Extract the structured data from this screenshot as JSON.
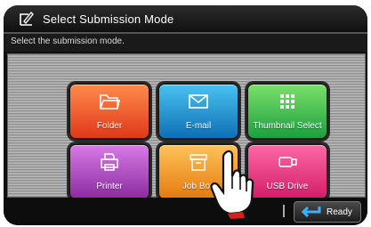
{
  "header": {
    "title": "Select Submission Mode",
    "icon": "pen-paper-icon"
  },
  "instruction": "Select the submission mode.",
  "tiles": [
    {
      "label": "Folder",
      "icon": "folder-icon",
      "color": "#f15a24"
    },
    {
      "label": "E-mail",
      "icon": "envelope-icon",
      "color": "#1e90d6"
    },
    {
      "label": "Thumbnail Select",
      "icon": "grid-icon",
      "color": "#34b44a"
    },
    {
      "label": "Printer",
      "icon": "printer-icon",
      "color": "#b04cc4"
    },
    {
      "label": "Job Box",
      "icon": "box-icon",
      "color": "#f59a22"
    },
    {
      "label": "USB Drive",
      "icon": "usb-icon",
      "color": "#e83a84"
    }
  ],
  "footer": {
    "ready_label": "Ready",
    "ready_icon": "return-arrow-icon"
  }
}
